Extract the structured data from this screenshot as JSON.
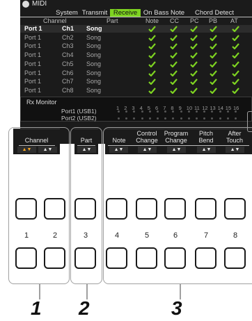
{
  "title": "MIDI",
  "tabs": [
    "System",
    "Transmit",
    "Receive",
    "On Bass Note",
    "Chord Detect"
  ],
  "active_tab": "Receive",
  "columns": [
    "Channel",
    "Part",
    "Note",
    "CC",
    "PC",
    "PB",
    "AT"
  ],
  "rows": [
    {
      "port": "Port 1",
      "ch": "Ch1",
      "part": "Song"
    },
    {
      "port": "Port 1",
      "ch": "Ch2",
      "part": "Song"
    },
    {
      "port": "Port 1",
      "ch": "Ch3",
      "part": "Song"
    },
    {
      "port": "Port 1",
      "ch": "Ch4",
      "part": "Song"
    },
    {
      "port": "Port 1",
      "ch": "Ch5",
      "part": "Song"
    },
    {
      "port": "Port 1",
      "ch": "Ch6",
      "part": "Song"
    },
    {
      "port": "Port 1",
      "ch": "Ch7",
      "part": "Song"
    },
    {
      "port": "Port 1",
      "ch": "Ch8",
      "part": "Song"
    }
  ],
  "rx_monitor": {
    "title": "Rx Monitor",
    "channels": [
      "1",
      "2",
      "3",
      "4",
      "5",
      "6",
      "7",
      "8",
      "9",
      "10",
      "11",
      "12",
      "13",
      "14",
      "15",
      "16"
    ],
    "ports": [
      "Port1 (USB1)",
      "Port2 (USB2)"
    ]
  },
  "panel": {
    "channel": {
      "label": "Channel"
    },
    "part": {
      "label": "Part"
    },
    "note": {
      "label": "Note"
    },
    "control_change": {
      "label1": "Control",
      "label2": "Change"
    },
    "program_change": {
      "label1": "Program",
      "label2": "Change"
    },
    "pitch_bend": {
      "label1": "Pitch",
      "label2": "Bend"
    },
    "after_touch": {
      "label1": "After",
      "label2": "Touch"
    }
  },
  "button_numbers": [
    "1",
    "2",
    "3",
    "4",
    "5",
    "6",
    "7",
    "8"
  ],
  "callouts": [
    "1",
    "2",
    "3"
  ],
  "colors": {
    "accent": "#7ed321",
    "screen_bg": "#1b1b1b",
    "check": "#7ed321"
  }
}
